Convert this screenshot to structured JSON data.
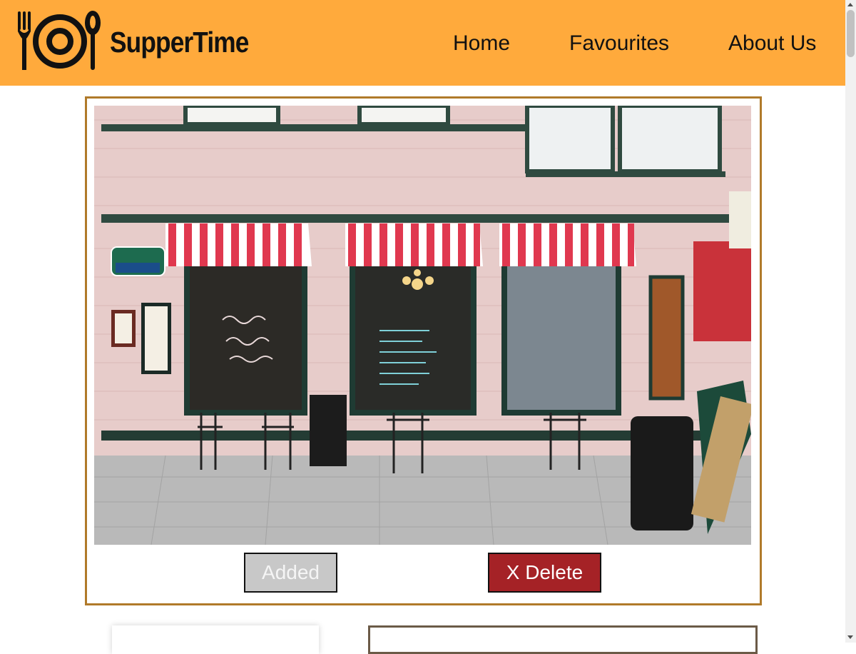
{
  "app": {
    "name": "SupperTime"
  },
  "nav": {
    "home": "Home",
    "favourites": "Favourites",
    "about": "About Us"
  },
  "card": {
    "image_alt": "Bistro storefront with red and white striped awnings",
    "added_label": "Added",
    "delete_label": "X Delete"
  },
  "colors": {
    "header": "#ffaa3c",
    "card_border": "#b07a2a",
    "added_button": "#c8c8c8",
    "delete_button": "#a52226"
  },
  "icons": {
    "logo": "fork-plate-spoon-icon"
  }
}
